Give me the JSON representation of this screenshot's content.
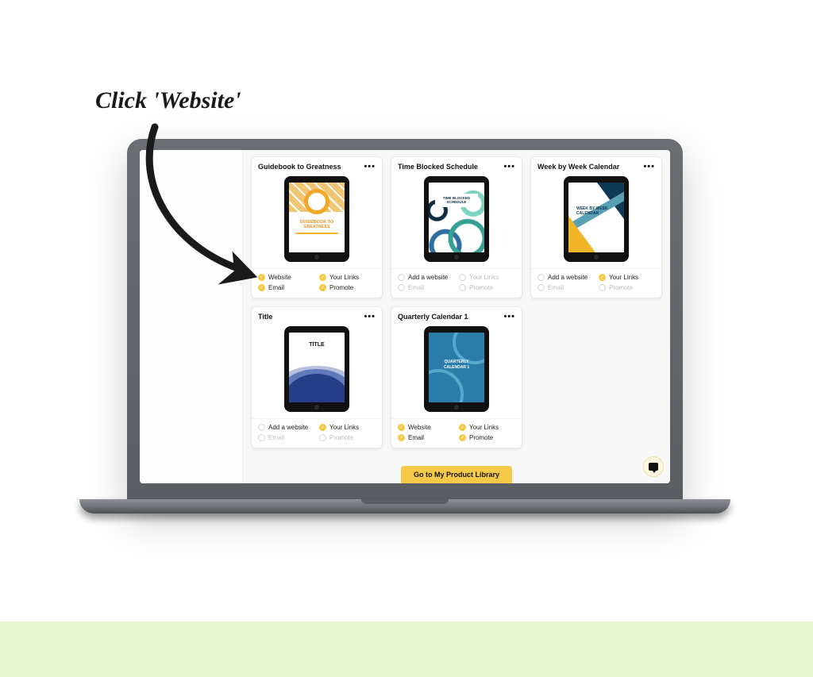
{
  "annotation": {
    "text": "Click 'Website'"
  },
  "library_button": "Go to My Product Library",
  "cards": [
    {
      "title": "Guidebook to Greatness",
      "cover_label": "GUIDEBOOK TO GREATNESS",
      "actions": [
        {
          "label": "Website",
          "checked": true,
          "disabled": false
        },
        {
          "label": "Your Links",
          "checked": true,
          "disabled": false
        },
        {
          "label": "Email",
          "checked": true,
          "disabled": false
        },
        {
          "label": "Promote",
          "checked": true,
          "disabled": false
        }
      ]
    },
    {
      "title": "Time Blocked Schedule",
      "cover_label": "TIME BLOCKED SCHEDULE",
      "actions": [
        {
          "label": "Add a website",
          "checked": false,
          "disabled": false
        },
        {
          "label": "Your Links",
          "checked": false,
          "disabled": true
        },
        {
          "label": "Email",
          "checked": false,
          "disabled": true
        },
        {
          "label": "Promote",
          "checked": false,
          "disabled": true
        }
      ]
    },
    {
      "title": "Week by Week Calendar",
      "cover_label": "WEEK BY WEEK CALENDAR",
      "actions": [
        {
          "label": "Add a website",
          "checked": false,
          "disabled": false
        },
        {
          "label": "Your Links",
          "checked": true,
          "disabled": false
        },
        {
          "label": "Email",
          "checked": false,
          "disabled": true
        },
        {
          "label": "Promote",
          "checked": false,
          "disabled": true
        }
      ]
    },
    {
      "title": "Title",
      "cover_label": "TITLE",
      "actions": [
        {
          "label": "Add a website",
          "checked": false,
          "disabled": false
        },
        {
          "label": "Your Links",
          "checked": true,
          "disabled": false
        },
        {
          "label": "Email",
          "checked": false,
          "disabled": true
        },
        {
          "label": "Promote",
          "checked": false,
          "disabled": true
        }
      ]
    },
    {
      "title": "Quarterly Calendar 1",
      "cover_label": "QUARTERLY CALENDAR 1",
      "actions": [
        {
          "label": "Website",
          "checked": true,
          "disabled": false
        },
        {
          "label": "Your Links",
          "checked": true,
          "disabled": false
        },
        {
          "label": "Email",
          "checked": true,
          "disabled": false
        },
        {
          "label": "Promote",
          "checked": true,
          "disabled": false
        }
      ]
    }
  ]
}
